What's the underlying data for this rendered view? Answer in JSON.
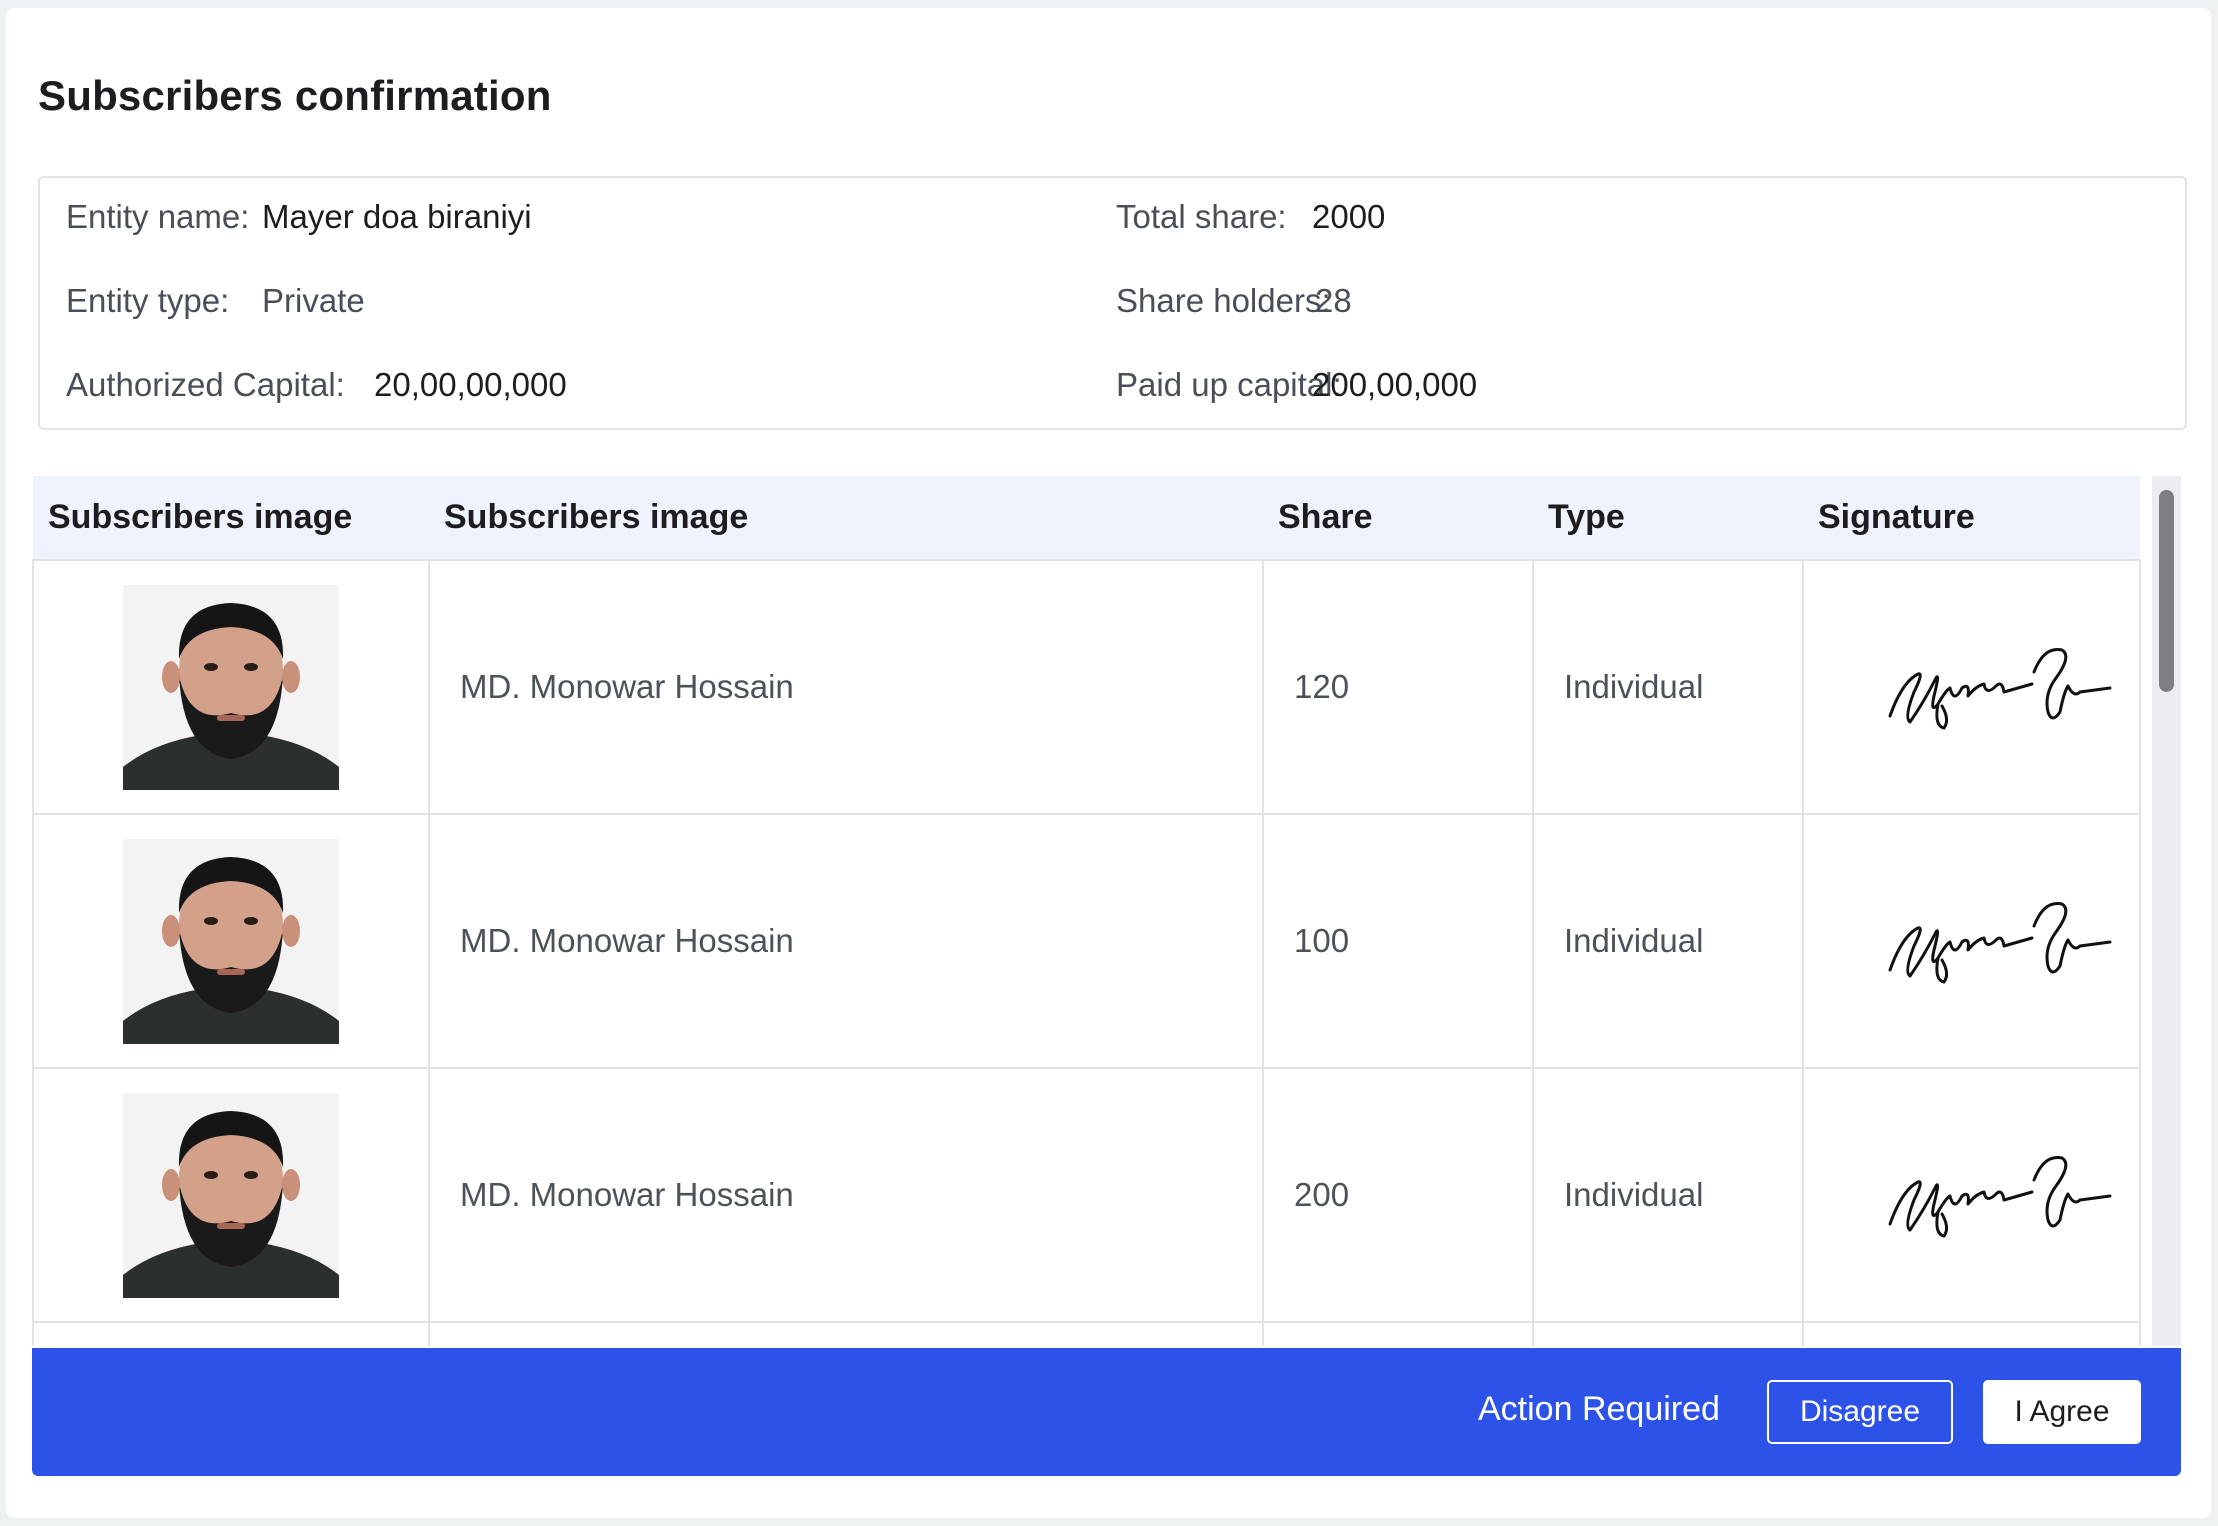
{
  "page": {
    "title": "Subscribers confirmation"
  },
  "entity": {
    "name_label": "Entity name:",
    "name_value": "Mayer doa biraniyi",
    "type_label": "Entity type:",
    "type_value": "Private",
    "authorized_label": "Authorized Capital:",
    "authorized_value": "20,00,00,000",
    "total_share_label": "Total share:",
    "total_share_value": "2000",
    "holders_label": "Share holders:",
    "holders_value": "28",
    "paid_label": "Paid up capital:",
    "paid_value": "200,00,000"
  },
  "table": {
    "headers": [
      "Subscribers image",
      "Subscribers image",
      "Share",
      "Type",
      "Signature"
    ],
    "rows": [
      {
        "name": "MD. Monowar Hossain",
        "share": "120",
        "type": "Individual"
      },
      {
        "name": "MD. Monowar Hossain",
        "share": "100",
        "type": "Individual"
      },
      {
        "name": "MD. Monowar Hossain",
        "share": "200",
        "type": "Individual"
      },
      {
        "name": "",
        "share": "",
        "type": ""
      }
    ]
  },
  "footer": {
    "status_text": "Action Required",
    "disagree_label": "Disagree",
    "agree_label": "I Agree"
  },
  "colors": {
    "accent": "#2c52e8",
    "header_bg": "#eff3fd"
  },
  "icons": {
    "photo": "person-photo",
    "signature": "handwritten-signature"
  }
}
